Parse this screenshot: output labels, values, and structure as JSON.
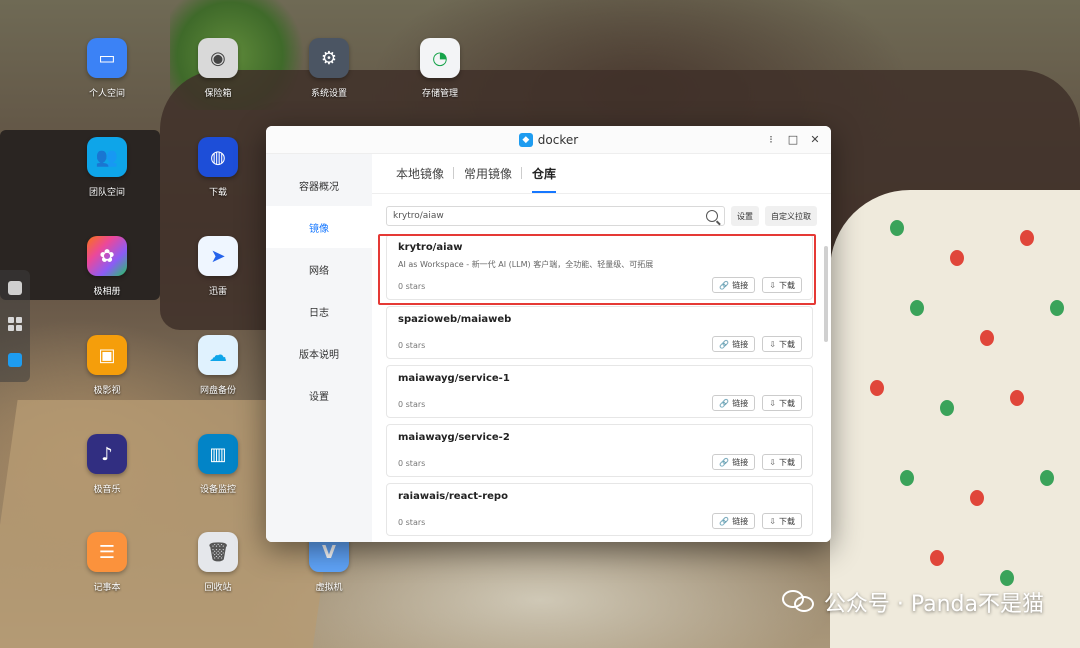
{
  "desktop": {
    "icons": [
      {
        "label": "个人空间",
        "icon": "folder-icon",
        "color": "#3b82f6"
      },
      {
        "label": "保险箱",
        "icon": "safe-icon",
        "color": "#d9d9d9"
      },
      {
        "label": "系统设置",
        "icon": "settings-icon",
        "color": "#4b5563"
      },
      {
        "label": "存储管理",
        "icon": "storage-icon",
        "color": "#f3f4f6"
      },
      {
        "label": "团队空间",
        "icon": "team-folder-icon",
        "color": "#0ea5e9"
      },
      {
        "label": "下载",
        "icon": "download-globe-icon",
        "color": "#1d4ed8"
      },
      {
        "label": "极相册",
        "icon": "photos-icon",
        "color": "#f97316"
      },
      {
        "label": "迅雷",
        "icon": "thunder-icon",
        "color": "#2563eb"
      },
      {
        "label": "极影视",
        "icon": "video-icon",
        "color": "#f59e0b"
      },
      {
        "label": "网盘备份",
        "icon": "cloud-backup-icon",
        "color": "#0ea5e9"
      },
      {
        "label": "极音乐",
        "icon": "music-icon",
        "color": "#4338ca"
      },
      {
        "label": "设备监控",
        "icon": "monitor-chart-icon",
        "color": "#0284c7"
      },
      {
        "label": "记事本",
        "icon": "notepad-icon",
        "color": "#fb923c"
      },
      {
        "label": "回收站",
        "icon": "trash-icon",
        "color": "#e5e7eb"
      },
      {
        "label": "虚拟机",
        "icon": "vm-icon",
        "color": "#60a5fa"
      }
    ]
  },
  "window": {
    "title": "docker",
    "controls": {
      "menu": "⁝",
      "maximize": "□",
      "close": "✕"
    }
  },
  "sidebar": {
    "items": [
      {
        "label": "容器概况"
      },
      {
        "label": "镜像"
      },
      {
        "label": "网络"
      },
      {
        "label": "日志"
      },
      {
        "label": "版本说明"
      },
      {
        "label": "设置"
      }
    ]
  },
  "tabs": [
    {
      "label": "本地镜像"
    },
    {
      "label": "常用镜像"
    },
    {
      "label": "仓库"
    }
  ],
  "search": {
    "value": "krytro/aiaw",
    "settings_label": "设置",
    "custom_pull_label": "自定义拉取"
  },
  "repos": [
    {
      "name": "krytro/aiaw",
      "description": "AI as Workspace - 新一代 AI (LLM) 客户端，全功能、轻量级、可拓展",
      "stars": "0 stars"
    },
    {
      "name": "spazioweb/maiaweb",
      "description": "",
      "stars": "0 stars"
    },
    {
      "name": "maiawayg/service-1",
      "description": "",
      "stars": "0 stars"
    },
    {
      "name": "maiawayg/service-2",
      "description": "",
      "stars": "0 stars"
    },
    {
      "name": "raiawais/react-repo",
      "description": "",
      "stars": "0 stars"
    }
  ],
  "actions": {
    "link_label": "链接",
    "download_label": "下载"
  },
  "watermark": "公众号 · Panda不是猫"
}
